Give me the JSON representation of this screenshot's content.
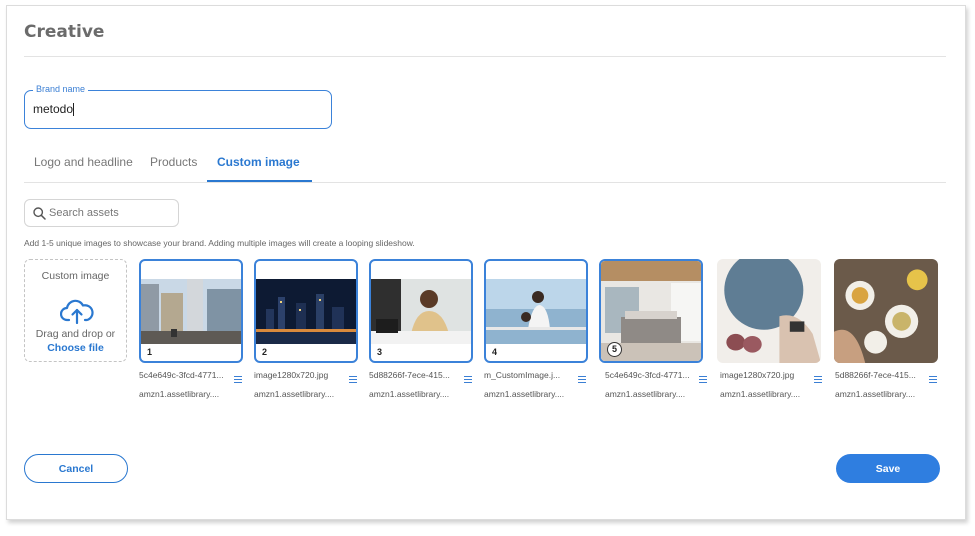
{
  "page": {
    "title": "Creative"
  },
  "brand": {
    "legend": "Brand name",
    "value": "metodo"
  },
  "tabs": [
    {
      "label": "Logo and headline",
      "active": false
    },
    {
      "label": "Products",
      "active": false
    },
    {
      "label": "Custom image",
      "active": true
    }
  ],
  "search": {
    "placeholder": "Search assets"
  },
  "helper_text": "Add 1-5 unique images to showcase your brand. Adding multiple images will create a looping slideshow.",
  "upload": {
    "title": "Custom image",
    "drag_text": "Drag and drop or",
    "choose_label": "Choose file"
  },
  "assets": [
    {
      "index": "1",
      "filename": "5c4e649c-3fcd-4771...",
      "source": "amzn1.assetlibrary....",
      "selected": true,
      "scene": "city-street"
    },
    {
      "index": "2",
      "filename": "image1280x720.jpg",
      "source": "amzn1.assetlibrary....",
      "selected": true,
      "scene": "night-skyline"
    },
    {
      "index": "3",
      "filename": "5d88266f-7ece-415...",
      "source": "amzn1.assetlibrary....",
      "selected": true,
      "scene": "man-writing-at-desk"
    },
    {
      "index": "4",
      "filename": "m_CustomImage.j...",
      "source": "amzn1.assetlibrary....",
      "selected": true,
      "scene": "family-balcony"
    },
    {
      "index": "5",
      "filename": "5c4e649c-3fcd-4771...",
      "source": "amzn1.assetlibrary....",
      "selected": true,
      "scene": "bedroom"
    },
    {
      "index": "",
      "filename": "image1280x720.jpg",
      "source": "amzn1.assetlibrary....",
      "selected": false,
      "scene": "fitness-weights"
    },
    {
      "index": "",
      "filename": "5d88266f-7ece-415...",
      "source": "amzn1.assetlibrary....",
      "selected": false,
      "scene": "dinner-table"
    }
  ],
  "buttons": {
    "cancel": "Cancel",
    "save": "Save"
  },
  "colors": {
    "accent": "#2a78d0",
    "save_bg": "#2f7ee0",
    "border": "#d5d5d5"
  },
  "icons": {
    "search": "search-icon",
    "upload": "cloud-upload-icon",
    "menu": "menu-icon"
  }
}
